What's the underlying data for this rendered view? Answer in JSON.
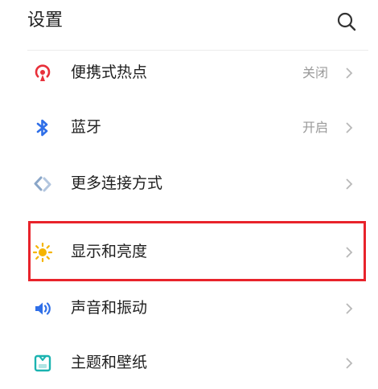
{
  "header": {
    "title": "设置",
    "search_icon": "search-icon"
  },
  "items": [
    {
      "label": "便携式热点",
      "status": "关闭",
      "icon": "hotspot-icon",
      "icon_color": "#e8303a"
    },
    {
      "label": "蓝牙",
      "status": "开启",
      "icon": "bluetooth-icon",
      "icon_color": "#2f6fe8"
    },
    {
      "label": "更多连接方式",
      "status": "",
      "icon": "connections-icon",
      "icon_color": "#8aa6c8"
    },
    {
      "label": "显示和亮度",
      "status": "",
      "icon": "brightness-icon",
      "icon_color": "#f5b400"
    },
    {
      "label": "声音和振动",
      "status": "",
      "icon": "sound-icon",
      "icon_color": "#2f6fe8"
    },
    {
      "label": "主题和壁纸",
      "status": "",
      "icon": "theme-icon",
      "icon_color": "#1bb3b0"
    }
  ],
  "highlight": {
    "target": "显示和亮度",
    "color": "#e8232b"
  },
  "colors": {
    "text": "#1f1f1f",
    "secondary_text": "#9a9a9a",
    "chevron": "#b8b8b8",
    "background": "#ffffff"
  }
}
